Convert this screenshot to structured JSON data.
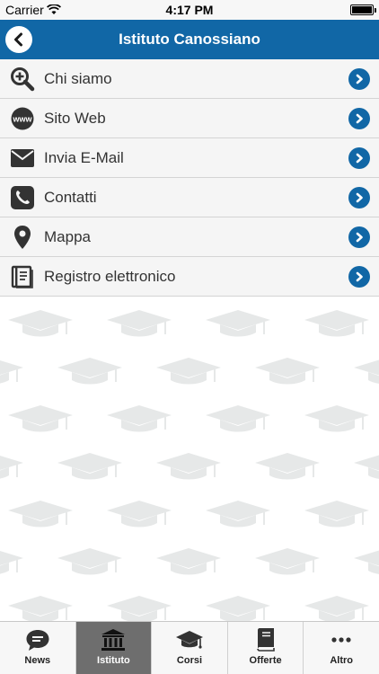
{
  "status": {
    "carrier": "Carrier",
    "time": "4:17 PM"
  },
  "nav": {
    "title": "Istituto Canossiano"
  },
  "menu": [
    {
      "label": "Chi siamo",
      "icon": "zoom-in-icon"
    },
    {
      "label": "Sito Web",
      "icon": "www-icon"
    },
    {
      "label": "Invia E-Mail",
      "icon": "envelope-icon"
    },
    {
      "label": "Contatti",
      "icon": "phone-icon"
    },
    {
      "label": "Mappa",
      "icon": "map-pin-icon"
    },
    {
      "label": "Registro elettronico",
      "icon": "register-book-icon"
    }
  ],
  "tabs": [
    {
      "label": "News",
      "icon": "speech-bubble-icon",
      "active": false
    },
    {
      "label": "Istituto",
      "icon": "institution-icon",
      "active": true
    },
    {
      "label": "Corsi",
      "icon": "graduation-cap-icon",
      "active": false
    },
    {
      "label": "Offerte",
      "icon": "book-icon",
      "active": false
    },
    {
      "label": "Altro",
      "icon": "more-dots-icon",
      "active": false
    }
  ],
  "colors": {
    "primary": "#1167a6",
    "active_tab": "#6e6e6e",
    "pattern": "#e6e8e8"
  }
}
